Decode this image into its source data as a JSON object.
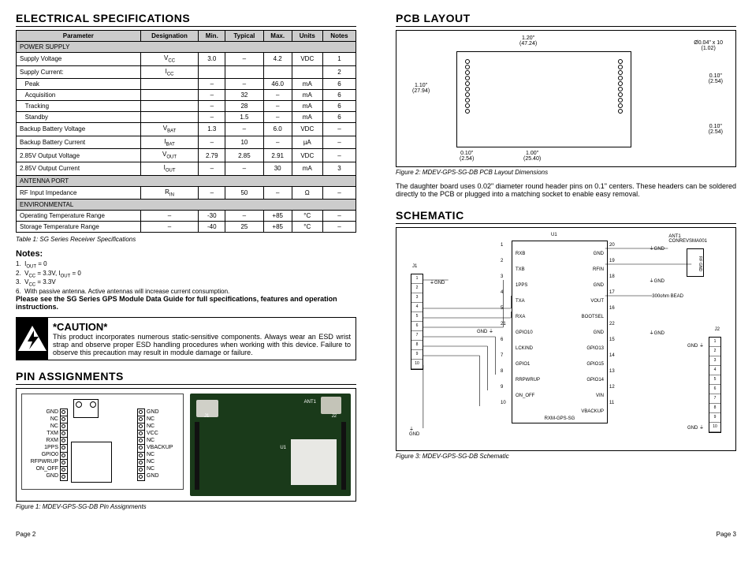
{
  "left": {
    "h_elec": "ELECTRICAL SPECIFICATIONS",
    "table_headers": [
      "Parameter",
      "Designation",
      "Min.",
      "Typical",
      "Max.",
      "Units",
      "Notes"
    ],
    "sections": [
      {
        "title": "POWER SUPPLY",
        "rows": [
          [
            "Supply Voltage",
            "V<sub>CC</sub>",
            "3.0",
            "–",
            "4.2",
            "VDC",
            "1"
          ],
          [
            "Supply Current:",
            "I<sub>CC</sub>",
            "",
            "",
            "",
            "",
            "2"
          ],
          [
            "&nbsp;&nbsp;&nbsp;Peak",
            "",
            "–",
            "–",
            "46.0",
            "mA",
            "6"
          ],
          [
            "&nbsp;&nbsp;&nbsp;Acquisition",
            "",
            "–",
            "32",
            "–",
            "mA",
            "6"
          ],
          [
            "&nbsp;&nbsp;&nbsp;Tracking",
            "",
            "–",
            "28",
            "–",
            "mA",
            "6"
          ],
          [
            "&nbsp;&nbsp;&nbsp;Standby",
            "",
            "–",
            "1.5",
            "–",
            "mA",
            "6"
          ],
          [
            "Backup Battery Voltage",
            "V<sub>BAT</sub>",
            "1.3",
            "–",
            "6.0",
            "VDC",
            "–"
          ],
          [
            "Backup Battery Current",
            "I<sub>BAT</sub>",
            "–",
            "10",
            "–",
            "µA",
            "–"
          ],
          [
            "2.85V Output Voltage",
            "V<sub>OUT</sub>",
            "2.79",
            "2.85",
            "2.91",
            "VDC",
            "–"
          ],
          [
            "2.85V Output Current",
            "I<sub>OUT</sub>",
            "–",
            "–",
            "30",
            "mA",
            "3"
          ]
        ]
      },
      {
        "title": "ANTENNA PORT",
        "rows": [
          [
            "RF Input Impedance",
            "R<sub>IN</sub>",
            "–",
            "50",
            "–",
            "Ω",
            "–"
          ]
        ]
      },
      {
        "title": "ENVIRONMENTAL",
        "rows": [
          [
            "Operating Temperature Range",
            "–",
            "-30",
            "–",
            "+85",
            "°C",
            "–"
          ],
          [
            "Storage Temperature Range",
            "–",
            "-40",
            "25",
            "+85",
            "°C",
            "–"
          ]
        ]
      }
    ],
    "table_caption": "Table 1: SG Series Receiver Specifications",
    "notes_h": "Notes:",
    "notes": [
      "I<sub>OUT</sub> = 0",
      "V<sub>CC</sub> = 3.3V, I<sub>OUT</sub> = 0",
      "V<sub>CC</sub> = 3.3V",
      "With passive antenna. Active antennas will increase current consumption."
    ],
    "note_numbers": [
      "1.",
      "2.",
      "3.",
      "6."
    ],
    "bold_note": "Please see the SG Series GPS Module Data Guide for full specifications, features and operation instructions.",
    "caution_h": "*CAUTION*",
    "caution_body": "This product incorporates numerous static-sensitive components. Always wear an ESD wrist strap and observe proper ESD handling procedures when working with this device. Failure to observe this precaution may result in module damage or failure.",
    "h_pins": "PIN ASSIGNMENTS",
    "pins_left": [
      "GND",
      "NC",
      "NC",
      "TXM",
      "RXM",
      "1PPS",
      "GPIO0",
      "RFPWRUP",
      "ON_OFF",
      "GND"
    ],
    "pins_right": [
      "GND",
      "NC",
      "NC",
      "VCC",
      "NC",
      "VBACKUP",
      "NC",
      "NC",
      "NC",
      "GND"
    ],
    "fig1": "Figure 1: MDEV-GPS-SG-DB Pin Assignments",
    "page_l": "Page 2"
  },
  "right": {
    "h_pcb": "PCB LAYOUT",
    "dims": {
      "w_in": "1.20\"",
      "w_mm": "(47.24)",
      "h_in": "1.10\"",
      "h_mm": "(27.94)",
      "hole_in": "Ø0.04\" x 10",
      "hole_mm": "(1.02)",
      "pitch1_in": "0.10\"",
      "pitch1_mm": "(2.54)",
      "pitch2_in": "0.10\"",
      "pitch2_mm": "(2.54)",
      "off_in": "0.10\"",
      "off_mm": "(2.54)",
      "row_in": "1.00\"",
      "row_mm": "(25.40)"
    },
    "fig2": "Figure 2: MDEV-GPS-SG-DB PCB Layout Dimensions",
    "body": "The daughter board uses 0.02\" diameter round header pins on 0.1\" centers. These headers can be soldered directly to the PCB or plugged into a matching socket to enable easy removal.",
    "h_sch": "SCHEMATIC",
    "chip_ref": "U1",
    "chip_name": "RXM-GPS-SG",
    "ant": "ANT1",
    "ant_part": "CONREVSMA001",
    "bead": "300ohm BEAD",
    "rf_gnd": "RF GND",
    "gnd": "GND",
    "j1": "J1",
    "j2": "J2",
    "chip_pins_l": [
      "RXB",
      "TXB",
      "1PPS",
      "TXA",
      "RXA",
      "GPIO10",
      "LCKIND",
      "GPIO1",
      "RRPWRUP",
      "ON_OFF"
    ],
    "chip_pins_r": [
      "GND",
      "RFIN",
      "GND",
      "VOUT",
      "BOOTSEL",
      "GND",
      "GPIO13",
      "GPIO15",
      "GPIO14",
      "VIN",
      "VBACKUP"
    ],
    "nums_l": [
      "1",
      "2",
      "3",
      "4",
      "5",
      "21",
      "6",
      "7",
      "8",
      "9",
      "10"
    ],
    "nums_r": [
      "20",
      "19",
      "18",
      "17",
      "16",
      "22",
      "15",
      "14",
      "13",
      "12",
      "11"
    ],
    "conn_nums": [
      "1",
      "2",
      "3",
      "4",
      "5",
      "6",
      "7",
      "8",
      "9",
      "10"
    ],
    "fig3": "Figure 3: MDEV-GPS-SG-DB Schematic",
    "page_r": "Page 3"
  }
}
